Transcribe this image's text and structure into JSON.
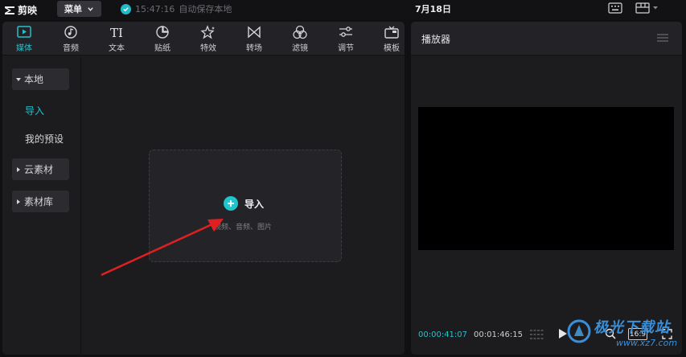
{
  "topbar": {
    "app_name": "剪映",
    "menu_label": "菜单",
    "save_time": "15:47:16",
    "save_text": "自动保存本地",
    "date": "7月18日"
  },
  "toolbar": {
    "tools": [
      {
        "label": "媒体",
        "icon": "media-icon",
        "active": true
      },
      {
        "label": "音频",
        "icon": "audio-icon",
        "active": false
      },
      {
        "label": "文本",
        "icon": "text-icon",
        "active": false
      },
      {
        "label": "贴纸",
        "icon": "sticker-icon",
        "active": false
      },
      {
        "label": "特效",
        "icon": "effects-icon",
        "active": false
      },
      {
        "label": "转场",
        "icon": "transition-icon",
        "active": false
      },
      {
        "label": "滤镜",
        "icon": "filter-icon",
        "active": false
      },
      {
        "label": "调节",
        "icon": "adjust-icon",
        "active": false
      },
      {
        "label": "模板",
        "icon": "template-icon",
        "active": false
      }
    ],
    "text_glyph": "TI"
  },
  "sidebar": {
    "items": [
      {
        "label": "本地",
        "type": "group",
        "expanded": true
      },
      {
        "label": "导入",
        "type": "sub",
        "active": true
      },
      {
        "label": "我的预设",
        "type": "sub",
        "active": false
      },
      {
        "label": "云素材",
        "type": "group",
        "expanded": false
      },
      {
        "label": "素材库",
        "type": "group",
        "expanded": false
      }
    ]
  },
  "import": {
    "label": "导入",
    "hint": "视频、音频、图片"
  },
  "player": {
    "title": "播放器",
    "time_current": "00:00:41:07",
    "time_total": "00:01:46:15",
    "ratio": "16:9"
  },
  "watermark": {
    "text": "极光下载站",
    "url": "www.xz7.com"
  },
  "colors": {
    "accent": "#24c1cc",
    "background": "#1c1c1f",
    "arrow": "#e02020"
  }
}
